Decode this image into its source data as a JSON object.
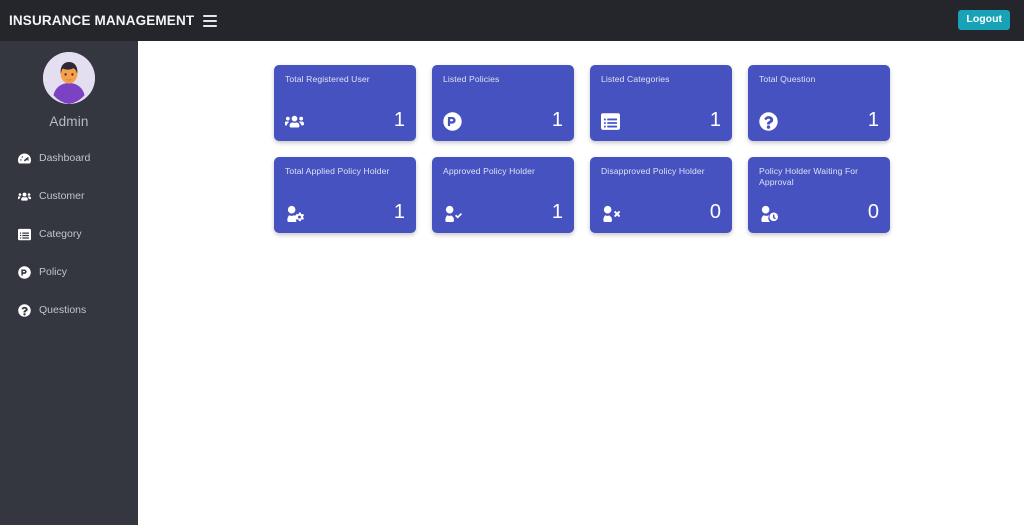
{
  "navbar": {
    "brand": "INSURANCE MANAGEMENT",
    "menu_toggle_icon": "hamburger-icon",
    "logout_label": "Logout",
    "logout_color": "#17a2b8",
    "background": "#24262c"
  },
  "sidebar": {
    "background": "#343640",
    "avatar_icon": "user-avatar",
    "user_name": "Admin",
    "items": [
      {
        "label": "Dashboard",
        "icon": "tachometer-icon"
      },
      {
        "label": "Customer",
        "icon": "users-icon"
      },
      {
        "label": "Category",
        "icon": "list-alt-icon"
      },
      {
        "label": "Policy",
        "icon": "product-hunt-icon"
      },
      {
        "label": "Questions",
        "icon": "question-circle-icon"
      }
    ]
  },
  "main": {
    "card_color": "#4652c0",
    "cards": [
      {
        "title": "Total Registered User",
        "value": "1",
        "icon": "users-icon"
      },
      {
        "title": "Listed Policies",
        "value": "1",
        "icon": "product-hunt-icon"
      },
      {
        "title": "Listed Categories",
        "value": "1",
        "icon": "list-alt-icon"
      },
      {
        "title": "Total Question",
        "value": "1",
        "icon": "question-circle-icon"
      },
      {
        "title": "Total Applied Policy Holder",
        "value": "1",
        "icon": "user-cog-icon"
      },
      {
        "title": "Approved Policy Holder",
        "value": "1",
        "icon": "user-check-icon"
      },
      {
        "title": "Disapproved Policy Holder",
        "value": "0",
        "icon": "user-times-icon"
      },
      {
        "title": "Policy Holder Waiting For Approval",
        "value": "0",
        "icon": "user-clock-icon"
      }
    ]
  }
}
